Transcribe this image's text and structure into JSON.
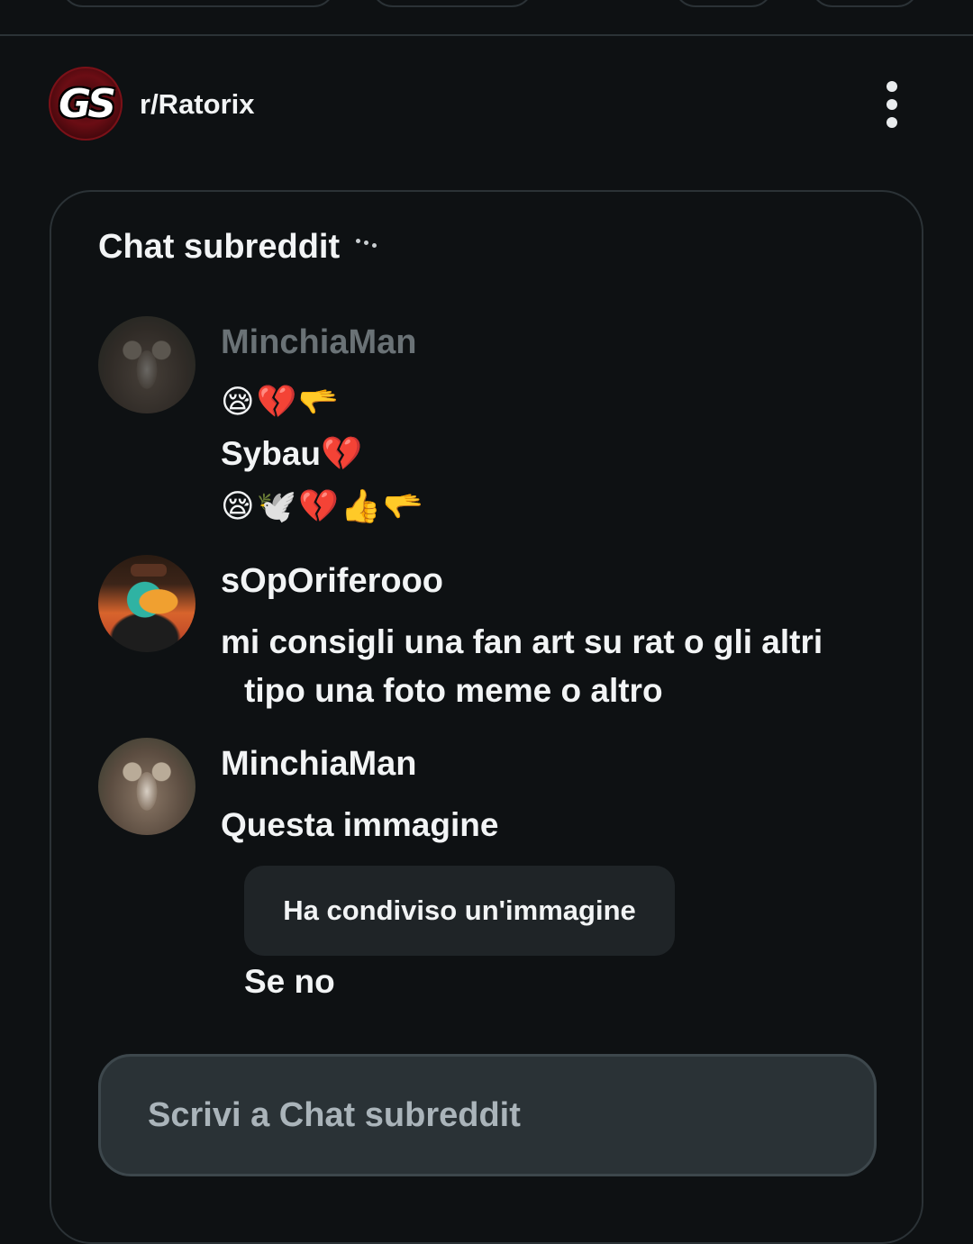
{
  "subreddit": {
    "name": "r/Ratorix",
    "avatar_text": "GS"
  },
  "chat": {
    "title": "Chat subreddit",
    "messages": [
      {
        "user": "MinchiaMan",
        "lines": [
          "😪💔🫳",
          "Sybau💔",
          "😪🕊️💔👍🫳"
        ]
      },
      {
        "user": "sOpOriferooo",
        "lines": [
          "mi consigli una fan art su rat o gli altri",
          "tipo una foto meme o altro"
        ]
      },
      {
        "user": "MinchiaMan",
        "lines": [
          "Questa immagine"
        ],
        "shared_image": "Ha condiviso un'immagine",
        "after": "Se no"
      }
    ],
    "composer_placeholder": "Scrivi a Chat subreddit"
  },
  "icons": {
    "menu": "kebab-menu-icon",
    "options": "more-options-icon"
  },
  "colors": {
    "background": "#0e1113",
    "card_border": "#2b3236",
    "composer_bg": "#2a3236"
  }
}
